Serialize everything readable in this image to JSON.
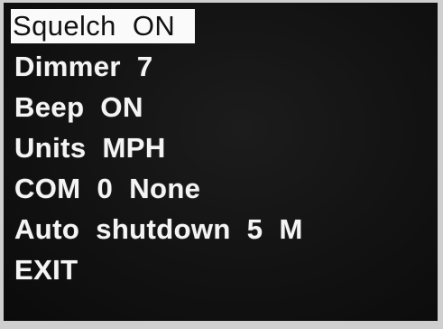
{
  "menu": {
    "items": [
      {
        "label": "Squelch  ON",
        "selected": true
      },
      {
        "label": "Dimmer  7",
        "selected": false
      },
      {
        "label": "Beep  ON",
        "selected": false
      },
      {
        "label": "Units  MPH",
        "selected": false
      },
      {
        "label": "COM  0  None",
        "selected": false
      },
      {
        "label": "Auto  shutdown  5  M",
        "selected": false
      },
      {
        "label": "EXIT",
        "selected": false
      }
    ]
  },
  "colors": {
    "background": "#121212",
    "text": "#f4f4f4",
    "highlight_bg": "#fafafa",
    "highlight_text": "#111111"
  }
}
